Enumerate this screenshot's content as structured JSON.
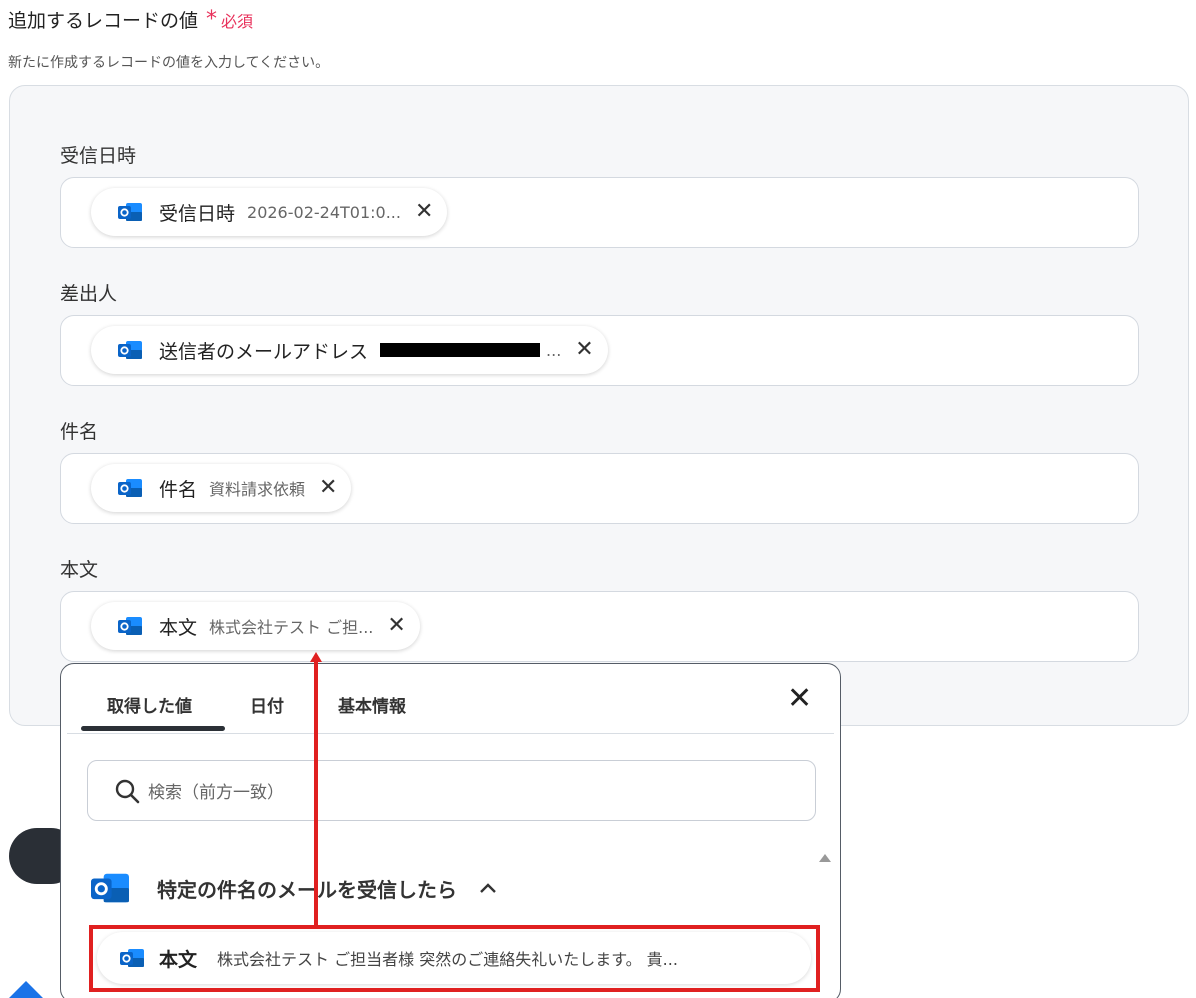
{
  "section": {
    "title": "追加するレコードの値",
    "required_mark": "*",
    "required_text": "必須",
    "description": "新たに作成するレコードの値を入力してください。"
  },
  "fields": [
    {
      "label": "受信日時",
      "chip_name": "受信日時",
      "chip_value": "2026-02-24T01:0...",
      "redacted": false
    },
    {
      "label": "差出人",
      "chip_name": "送信者のメールアドレス",
      "chip_value": "...",
      "redacted": true
    },
    {
      "label": "件名",
      "chip_name": "件名",
      "chip_value": "資料請求依頼",
      "redacted": false
    },
    {
      "label": "本文",
      "chip_name": "本文",
      "chip_value": "株式会社テスト ご担...",
      "redacted": false
    }
  ],
  "dropdown": {
    "tabs": [
      "取得した値",
      "日付",
      "基本情報"
    ],
    "active_tab": "取得した値",
    "search_placeholder": "検索（前方一致）",
    "group_title": "特定の件名のメールを受信したら",
    "result": {
      "name": "本文",
      "value": "株式会社テスト ご担当者様 突然のご連絡失礼いたします。 貴..."
    }
  },
  "icons": {
    "outlook": "outlook-icon",
    "remove": "close-icon",
    "search": "search-icon",
    "collapse": "chevron-up-icon"
  },
  "colors": {
    "required": "#e8315b",
    "annotation": "#e02020",
    "outlook_blue": "#0a64c8"
  }
}
